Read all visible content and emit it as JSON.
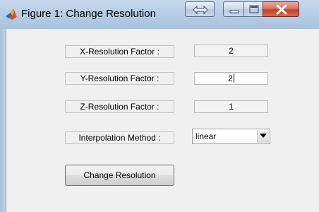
{
  "window": {
    "title": "Figure 1: Change Resolution",
    "icon": "matlab-icon",
    "buttons": [
      "resize-icon",
      "minimize-icon",
      "maximize-icon",
      "close-icon"
    ]
  },
  "form": {
    "x_label": "X-Resolution Factor :",
    "x_value": "2",
    "y_label": "Y-Resolution Factor :",
    "y_value": "2",
    "z_label": "Z-Resolution Factor :",
    "z_value": "1",
    "interp_label": "Interpolation Method :",
    "interp_value": "linear",
    "submit_label": "Change Resolution"
  }
}
